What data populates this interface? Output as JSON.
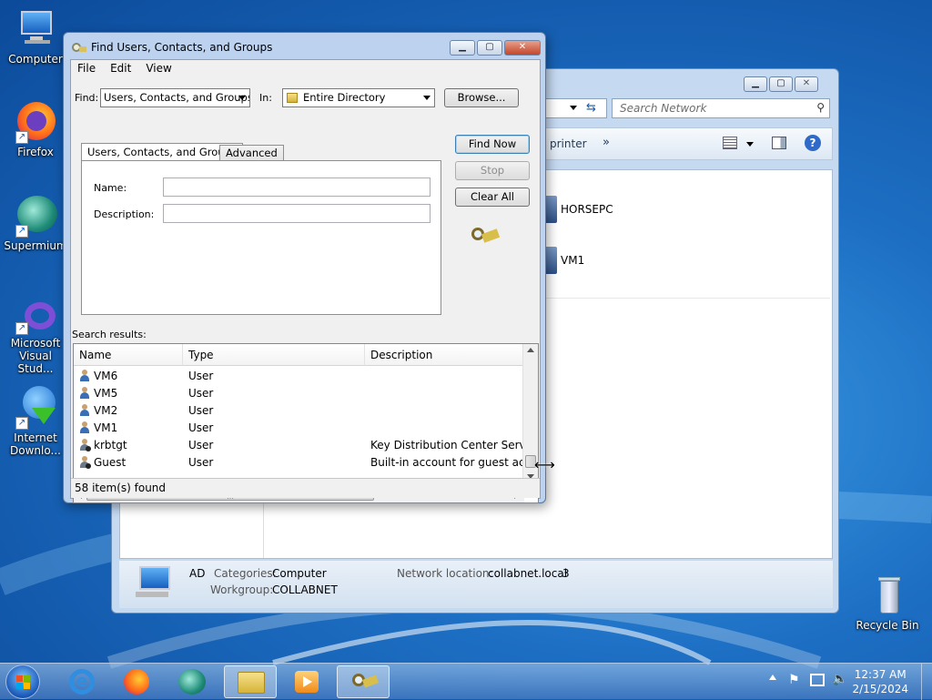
{
  "desktop": {
    "icons": [
      {
        "label_line1": "Computer",
        "label_line2": ""
      },
      {
        "label_line1": "Firefox",
        "label_line2": ""
      },
      {
        "label_line1": "Supermium",
        "label_line2": ""
      },
      {
        "label_line1": "Microsoft",
        "label_line2": "Visual Stud..."
      },
      {
        "label_line1": "Internet",
        "label_line2": "Downlo..."
      },
      {
        "label_line1": "Recycle Bin",
        "label_line2": ""
      }
    ]
  },
  "explorer": {
    "search_placeholder": "Search Network",
    "toolbar_printer": "printer",
    "toolbar_more": "»",
    "items": [
      "HORSEPC",
      "VM1"
    ],
    "details": {
      "name": "AD",
      "categories_label": "Categories:",
      "categories_value": "Computer",
      "workgroup_label": "Workgroup:",
      "workgroup_value": "COLLABNET",
      "network_label": "Network location:",
      "network_value": "collabnet.local",
      "network_extra": "3"
    }
  },
  "dialog": {
    "title": "Find Users, Contacts, and Groups",
    "menu": [
      "File",
      "Edit",
      "View"
    ],
    "find_label": "Find:",
    "find_value": "Users, Contacts, and Groups",
    "in_label": "In:",
    "in_value": "Entire Directory",
    "browse_label": "Browse...",
    "tabs": [
      "Users, Contacts, and Groups",
      "Advanced"
    ],
    "name_label": "Name:",
    "description_label": "Description:",
    "find_now": "Find Now",
    "stop": "Stop",
    "clear_all": "Clear All",
    "results_label": "Search results:",
    "columns": [
      "Name",
      "Type",
      "Description"
    ],
    "rows": [
      {
        "name": "VM6",
        "type": "User",
        "description": ""
      },
      {
        "name": "VM5",
        "type": "User",
        "description": ""
      },
      {
        "name": "VM2",
        "type": "User",
        "description": ""
      },
      {
        "name": "VM1",
        "type": "User",
        "description": ""
      },
      {
        "name": "krbtgt",
        "type": "User",
        "description": "Key Distribution Center Service A"
      },
      {
        "name": "Guest",
        "type": "User",
        "description": "Built-in account for guest acces"
      }
    ],
    "status": "58 item(s) found"
  },
  "taskbar": {
    "time": "12:37 AM",
    "date": "2/15/2024"
  }
}
